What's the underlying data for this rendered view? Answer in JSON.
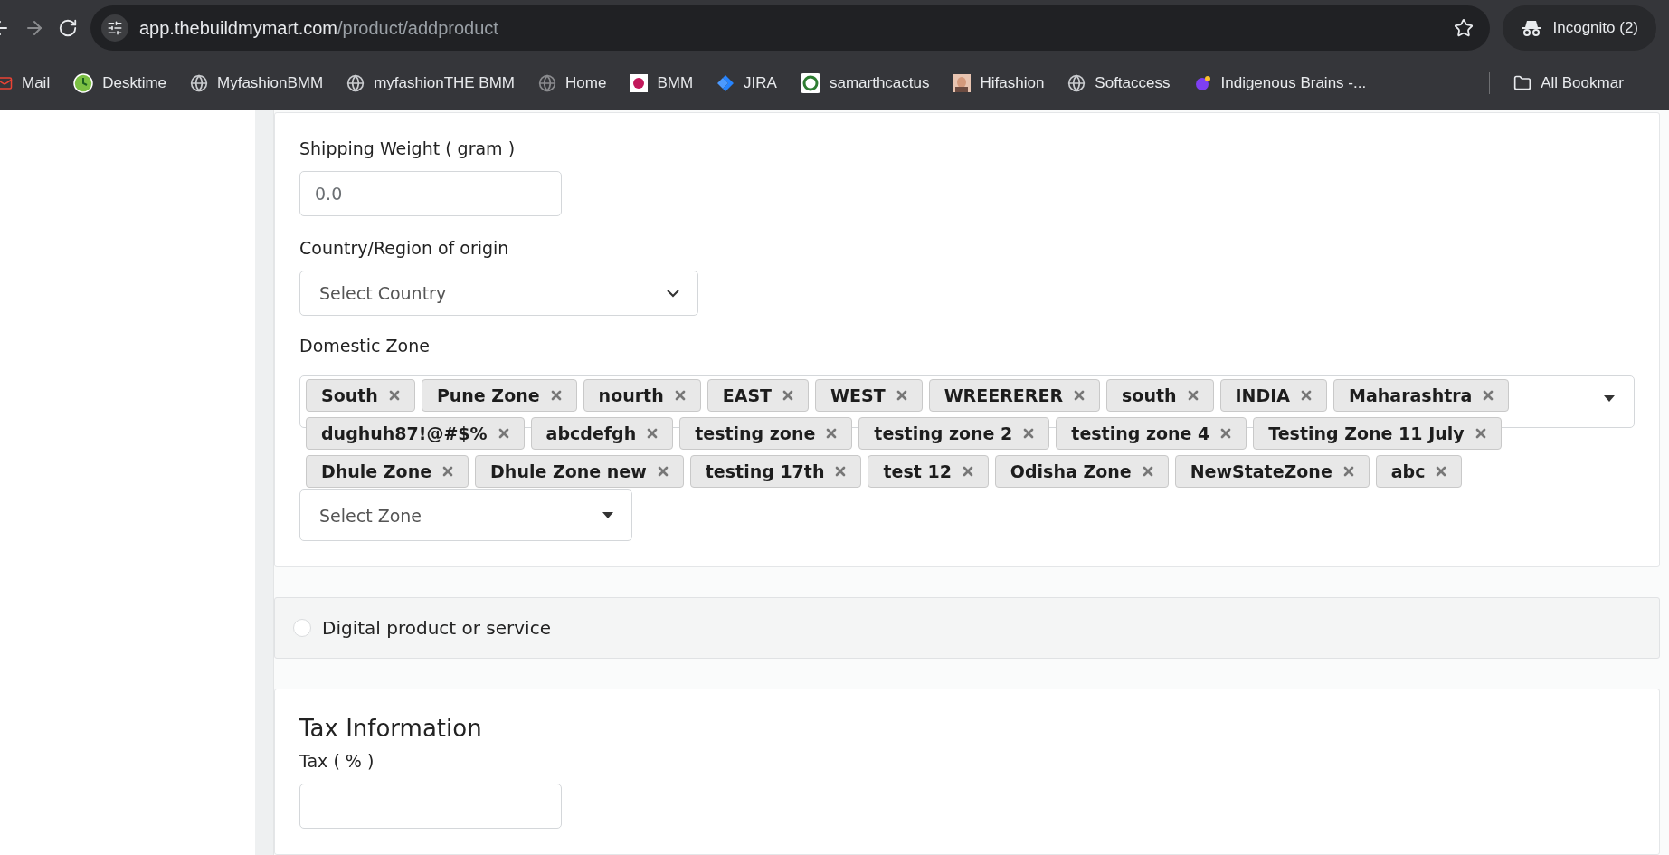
{
  "browser": {
    "address": {
      "domain": "app.thebuildmymart.com",
      "path": "/product/addproduct"
    },
    "profile": "Incognito (2)",
    "bookmarks": [
      {
        "label": "Mail",
        "kind": "mail"
      },
      {
        "label": "Desktime",
        "kind": "clock"
      },
      {
        "label": "MyfashionBMM",
        "kind": "globe"
      },
      {
        "label": "myfashionTHE BMM",
        "kind": "globe"
      },
      {
        "label": "Home",
        "kind": "globe-dim"
      },
      {
        "label": "BMM",
        "kind": "badge"
      },
      {
        "label": "JIRA",
        "kind": "jira"
      },
      {
        "label": "samarthcactus",
        "kind": "ring"
      },
      {
        "label": "Hifashion"
      },
      {
        "label": "Softaccess",
        "kind": "globe"
      },
      {
        "label": "Indigenous Brains -...",
        "kind": "brain"
      }
    ],
    "all_bookmarks": "All Bookmar"
  },
  "shipping": {
    "weight_label": "Shipping Weight ( gram )",
    "weight_placeholder": "0.0",
    "country_label": "Country/Region of origin",
    "country_placeholder": "Select Country",
    "domestic_label": "Domestic Zone",
    "domestic_tags": [
      "South",
      "Pune Zone",
      "nourth",
      "EAST",
      "WEST",
      "WREERERER",
      "south",
      "INDIA",
      "Maharashtra",
      "dughuh87!@#$%",
      "abcdefgh",
      "testing zone",
      "testing zone 2",
      "testing zone 4",
      "Testing Zone 11 July",
      "Dhule Zone",
      "Dhule Zone new",
      "testing 17th",
      "test 12",
      "Odisha Zone",
      "NewStateZone",
      "abc"
    ],
    "international_placeholder": "Select Zone"
  },
  "digital_product": {
    "label": "Digital product or service",
    "selected": false
  },
  "tax": {
    "title": "Tax Information",
    "label": "Tax ( % )"
  }
}
